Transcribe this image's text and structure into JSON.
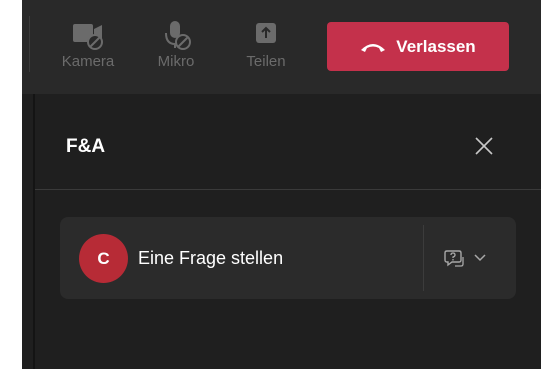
{
  "toolbar": {
    "camera_label": "Kamera",
    "mic_label": "Mikro",
    "share_label": "Teilen",
    "leave_label": "Verlassen"
  },
  "panel": {
    "title": "F&A",
    "avatar_initial": "C",
    "ask_placeholder": "Eine Frage stellen"
  },
  "icons": {
    "camera": "camera-off-icon",
    "mic": "mic-off-icon",
    "share": "share-upload-icon",
    "leave": "hang-up-icon",
    "close": "close-icon",
    "question_type": "question-bubble-icon",
    "options": "chevron-down-icon"
  },
  "colors": {
    "leave_button": "#c4314b",
    "avatar": "#b72b36",
    "toolbar_bg": "#292929",
    "panel_bg": "#1f1f1f",
    "card_bg": "#2b2b2b",
    "disabled_text": "#6b6b6b"
  }
}
